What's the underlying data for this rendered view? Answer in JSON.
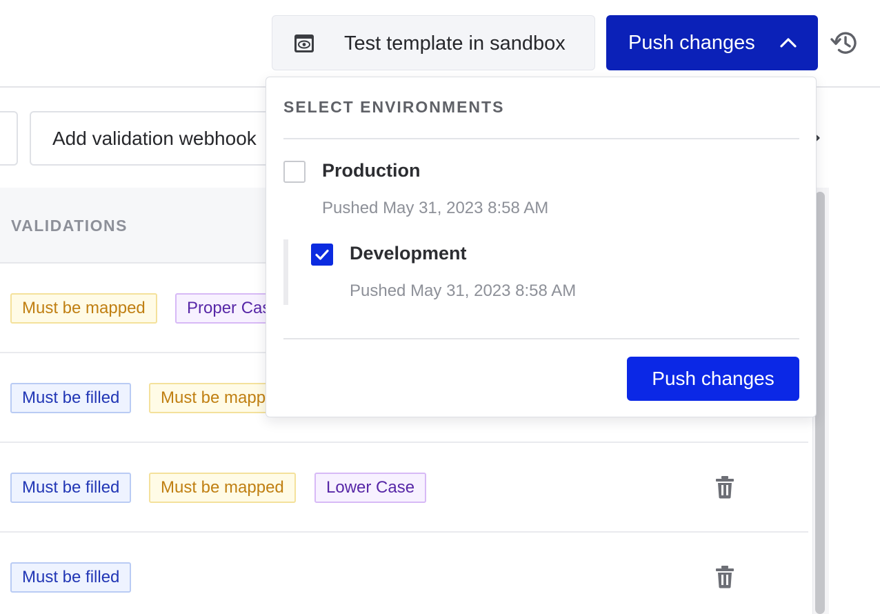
{
  "header": {
    "sandbox_button_label": "Test template in sandbox",
    "push_button_label": "Push changes"
  },
  "toolbar": {
    "webhook_button_label": "Add validation webhook"
  },
  "table": {
    "column_header": "VALIDATIONS",
    "rows": [
      {
        "tags": [
          "Must be mapped",
          "Proper Case"
        ]
      },
      {
        "tags": [
          "Must be filled",
          "Must be mapped"
        ]
      },
      {
        "tags": [
          "Must be filled",
          "Must be mapped",
          "Lower Case"
        ]
      },
      {
        "tags": [
          "Must be filled"
        ]
      }
    ]
  },
  "dropdown": {
    "title": "SELECT ENVIRONMENTS",
    "environments": [
      {
        "name": "Production",
        "pushed": "Pushed May 31, 2023 8:58 AM",
        "checked": false
      },
      {
        "name": "Development",
        "pushed": "Pushed May 31, 2023 8:58 AM",
        "checked": true
      }
    ],
    "push_button_label": "Push changes"
  },
  "colors": {
    "primary_blue": "#0b21b8",
    "accent_blue": "#0b28e6",
    "tag_mapped": "#c07f12",
    "tag_filled": "#2136b5",
    "tag_case": "#5727a7"
  },
  "icons": [
    "eye-sandbox-icon",
    "chevron-up-icon",
    "history-icon",
    "trash-icon",
    "checkmark-icon",
    "chevron-right-icon"
  ]
}
